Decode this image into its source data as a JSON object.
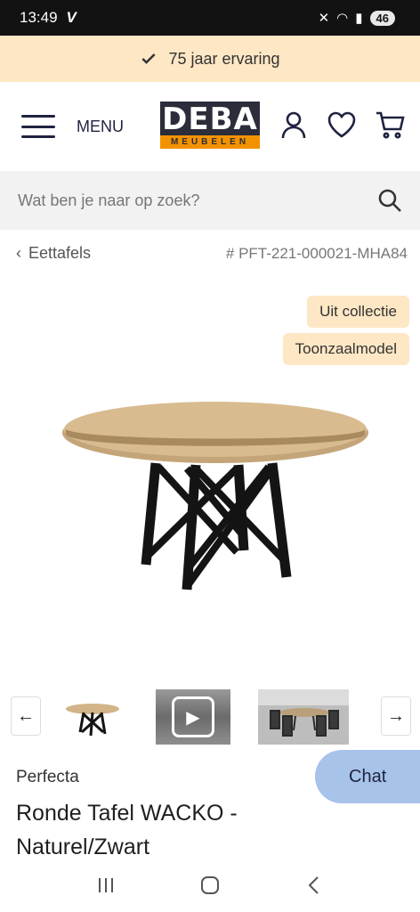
{
  "status_bar": {
    "time": "13:49",
    "carrier_glyph": "V",
    "battery": "46"
  },
  "promo": {
    "text": "75 jaar ervaring",
    "icon": "check-icon"
  },
  "header": {
    "menu_label": "MENU",
    "logo": {
      "top": "DEBA",
      "bottom": "MEUBELEN"
    },
    "icons": [
      "account-icon",
      "heart-icon",
      "cart-icon"
    ]
  },
  "search": {
    "placeholder": "Wat ben je naar op zoek?"
  },
  "breadcrumb": {
    "back_label": "Eettafels",
    "sku": "# PFT-221-000021-MHA84"
  },
  "badges": [
    "Uit collectie",
    "Toonzaalmodel"
  ],
  "gallery": {
    "prev_label": "←",
    "next_label": "→"
  },
  "product": {
    "brand": "Perfecta",
    "title": "Ronde Tafel WACKO - Naturel/Zwart"
  },
  "chat": {
    "label": "Chat"
  },
  "colors": {
    "promo_bg": "#fde7c4",
    "chat_bg": "#a7c3ea",
    "logo_dark": "#2b2d3a",
    "logo_accent": "#f39200"
  }
}
